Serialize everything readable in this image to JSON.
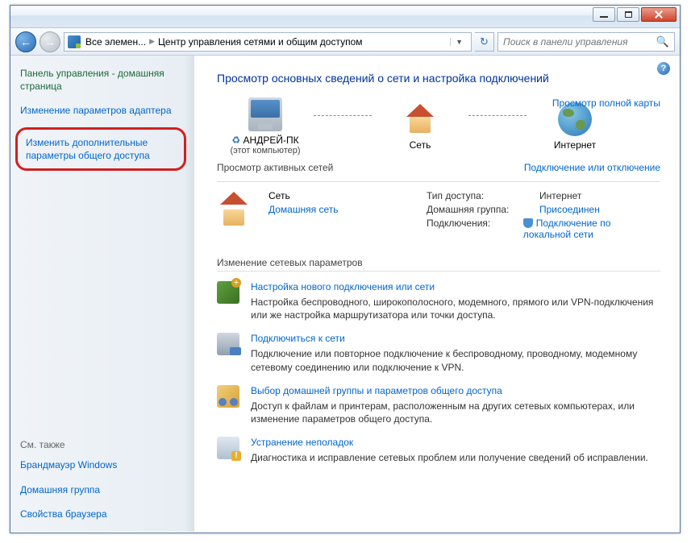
{
  "titlebar": {},
  "nav": {
    "address_root": "Все элемен...",
    "address_current": "Центр управления сетями и общим доступом",
    "search_placeholder": "Поиск в панели управления"
  },
  "sidebar": {
    "heading": "Панель управления - домашняя страница",
    "link_adapter": "Изменение параметров адаптера",
    "link_advanced": "Изменить дополнительные параметры общего доступа",
    "footer_heading": "См. также",
    "footer_links": {
      "firewall": "Брандмауэр Windows",
      "homegroup": "Домашняя группа",
      "browser": "Свойства браузера"
    }
  },
  "main": {
    "title": "Просмотр основных сведений о сети и настройка подключений",
    "fullmap_link": "Просмотр полной карты",
    "nodes": {
      "pc": "АНДРЕЙ-ПК",
      "pc_sub": "(этот компьютер)",
      "network": "Сеть",
      "internet": "Интернет"
    },
    "active_section": "Просмотр активных сетей",
    "active_link": "Подключение или отключение",
    "netinfo": {
      "name": "Сеть",
      "type": "Домашняя сеть",
      "access_key": "Тип доступа:",
      "access_val": "Интернет",
      "homegroup_key": "Домашняя группа:",
      "homegroup_val": "Присоединен",
      "conn_key": "Подключения:",
      "conn_val": "Подключение по локальной сети"
    },
    "change_heading": "Изменение сетевых параметров",
    "tasks": [
      {
        "title": "Настройка нового подключения или сети",
        "desc": "Настройка беспроводного, широкополосного, модемного, прямого или VPN-подключения или же настройка маршрутизатора или точки доступа."
      },
      {
        "title": "Подключиться к сети",
        "desc": "Подключение или повторное подключение к беспроводному, проводному, модемному сетевому соединению или подключение к VPN."
      },
      {
        "title": "Выбор домашней группы и параметров общего доступа",
        "desc": "Доступ к файлам и принтерам, расположенным на других сетевых компьютерах, или изменение параметров общего доступа."
      },
      {
        "title": "Устранение неполадок",
        "desc": "Диагностика и исправление сетевых проблем или получение сведений об исправлении."
      }
    ]
  }
}
